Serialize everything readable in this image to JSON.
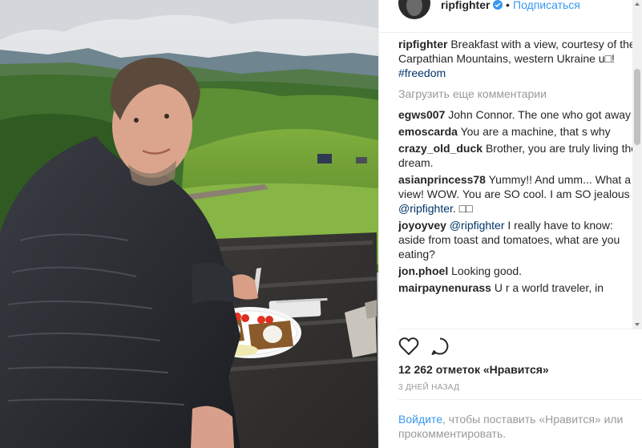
{
  "header": {
    "username": "ripfighter",
    "dot": "•",
    "follow_label": "Подписаться"
  },
  "caption": {
    "username": "ripfighter",
    "text": "Breakfast with a view, courtesy of the Carpathian Mountains, western Ukraine u⁠□! ",
    "hashtag": "#freedom"
  },
  "load_more_label": "Загрузить еще комментарии",
  "comments": [
    {
      "user": "egws007",
      "text": "John Connor. The one who got away"
    },
    {
      "user": "emoscarda",
      "text": "You are a machine, that s why"
    },
    {
      "user": "crazy_old_duck",
      "text": "Brother, you are truly living the dream."
    },
    {
      "user": "asianprincess78",
      "text": "Yummy!! And umm... What a view! WOW. You are SO cool. I am SO jealous ",
      "mention": "@ripfighter",
      "tail": ". □□"
    },
    {
      "user": "joyoyvey",
      "mention": "@ripfighter",
      "text": "I really have to know: aside from toast and tomatoes, what are you eating?"
    },
    {
      "user": "jon.phoel",
      "text": "Looking good."
    },
    {
      "user": "mairpaynenurass",
      "text": "U r a world traveler, in"
    }
  ],
  "likes_text": "12 262 отметок «Нравится»",
  "time_text": "3 ДНЕЙ НАЗАД",
  "login": {
    "link": "Войдите",
    "rest": ", чтобы поставить «Нравится» или прокомментировать."
  },
  "icons": {
    "verified": "verified-badge-icon",
    "heart": "heart-icon",
    "comment": "comment-bubble-icon"
  },
  "colors": {
    "link_blue": "#3897f0",
    "hashtag_blue": "#003569",
    "text": "#262626",
    "muted": "#999999"
  }
}
